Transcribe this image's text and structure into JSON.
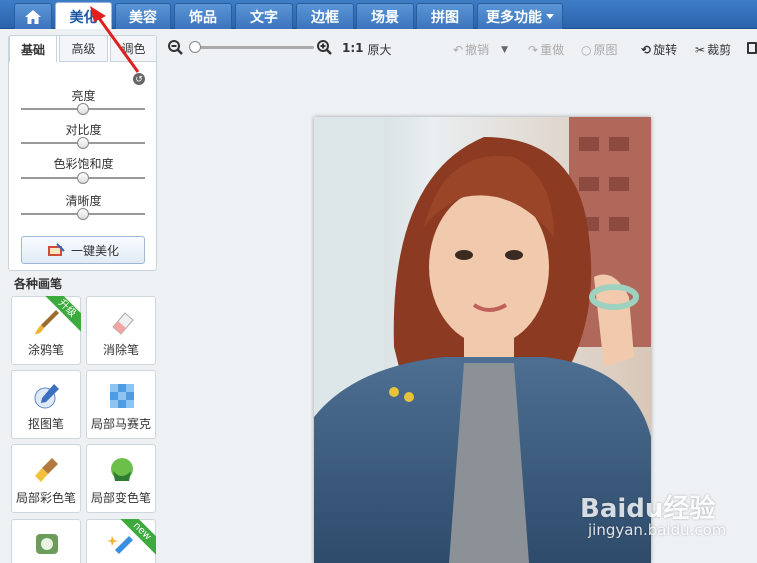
{
  "nav": {
    "home_icon": "home-icon",
    "tabs": [
      {
        "label": "美化",
        "active": true
      },
      {
        "label": "美容"
      },
      {
        "label": "饰品"
      },
      {
        "label": "文字"
      },
      {
        "label": "边框"
      },
      {
        "label": "场景"
      },
      {
        "label": "拼图"
      },
      {
        "label": "更多功能"
      }
    ]
  },
  "adjust_panel": {
    "tabs": [
      "基础",
      "高级",
      "调色"
    ],
    "sliders": [
      {
        "label": "亮度",
        "level": 0.5
      },
      {
        "label": "对比度",
        "level": 0.5
      },
      {
        "label": "色彩饱和度",
        "level": 0.5
      },
      {
        "label": "清晰度",
        "level": 0.5
      }
    ],
    "beautify_button": "一键美化"
  },
  "brushes": {
    "title": "各种画笔",
    "items": [
      {
        "label": "涂鸦笔",
        "badge": "升级",
        "icon": "brush-icon"
      },
      {
        "label": "消除笔",
        "icon": "eraser-icon"
      },
      {
        "label": "抠图笔",
        "icon": "cutout-pen-icon"
      },
      {
        "label": "局部马赛克",
        "icon": "mosaic-icon"
      },
      {
        "label": "局部彩色笔",
        "icon": "color-brush-icon"
      },
      {
        "label": "局部变色笔",
        "icon": "color-change-icon"
      },
      {
        "label": "",
        "icon": "frame-icon"
      },
      {
        "label": "",
        "badge": "new",
        "icon": "magic-pen-icon"
      }
    ]
  },
  "toolbar": {
    "ratio_label": "1:1",
    "original_size": "原大",
    "undo": "撤销",
    "redo": "重做",
    "original": "原图",
    "rotate": "旋转",
    "crop": "裁剪"
  },
  "watermark": {
    "brand": "Baidu经验",
    "url": "jingyan.baidu.com"
  },
  "colors": {
    "nav_blue": "#2f6db6",
    "annotation_red": "#e02020",
    "badge_green": "#3daa3d"
  }
}
